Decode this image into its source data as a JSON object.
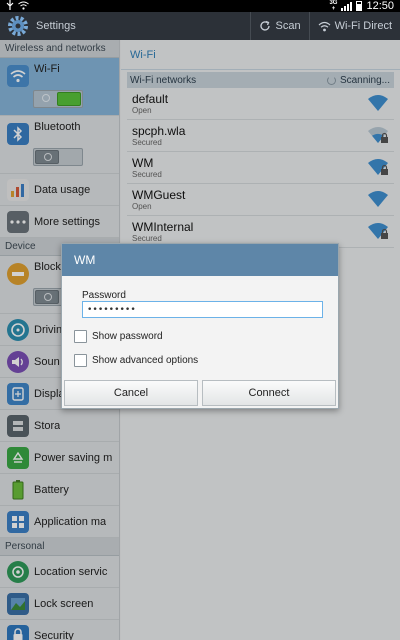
{
  "status_bar": {
    "network_type_top": "3G",
    "network_type_bottom": "+",
    "time": "12:50"
  },
  "action_bar": {
    "title": "Settings",
    "scan_label": "Scan",
    "wifi_direct_label": "Wi-Fi Direct"
  },
  "left_panel": {
    "section_wireless": "Wireless and networks",
    "wifi_label": "Wi-Fi",
    "bluetooth_label": "Bluetooth",
    "data_usage_label": "Data usage",
    "more_settings_label": "More settings",
    "section_device": "Device",
    "blocking_label": "Block",
    "driving_label": "Drivin",
    "sound_label": "Soun",
    "display_label": "Displa",
    "storage_label": "Stora",
    "power_saving_label": "Power saving m",
    "battery_label": "Battery",
    "application_label": "Application ma",
    "section_personal": "Personal",
    "location_label": "Location servic",
    "lock_screen_label": "Lock screen",
    "security_label": "Security"
  },
  "right_panel": {
    "title": "Wi-Fi",
    "networks_header": "Wi-Fi networks",
    "scanning_label": "Scanning...",
    "networks": [
      {
        "name": "default",
        "security": "Open"
      },
      {
        "name": "spcph.wla",
        "security": "Secured"
      },
      {
        "name": "WM",
        "security": "Secured"
      },
      {
        "name": "WMGuest",
        "security": "Open"
      },
      {
        "name": "WMInternal",
        "security": "Secured"
      }
    ]
  },
  "dialog": {
    "title": "WM",
    "password_label": "Password",
    "password_value": "•••••••••",
    "show_password_label": "Show password",
    "show_advanced_label": "Show advanced options",
    "cancel_label": "Cancel",
    "connect_label": "Connect"
  }
}
